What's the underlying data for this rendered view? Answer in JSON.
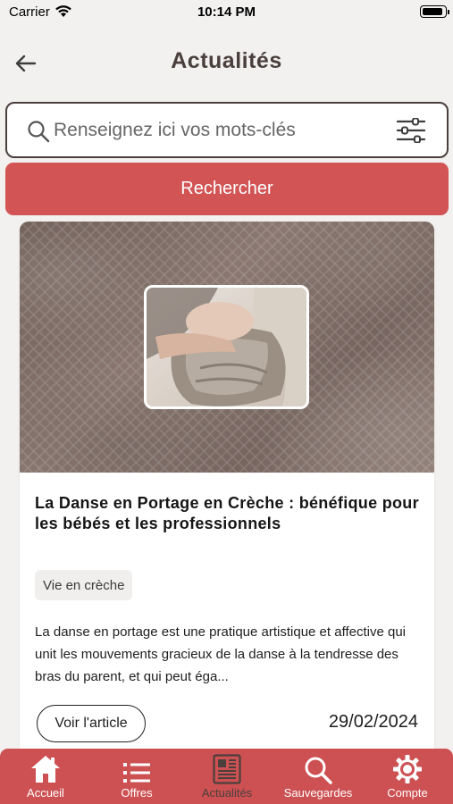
{
  "status_bar": {
    "carrier": "Carrier",
    "time": "10:14 PM"
  },
  "header": {
    "title": "Actualités"
  },
  "search": {
    "placeholder": "Renseignez ici vos mots-clés",
    "value": "",
    "button_label": "Rechercher"
  },
  "article": {
    "title": "La Danse en Portage en Crèche : bénéfique pour les bébés et les professionnels",
    "tag": "Vie en crèche",
    "excerpt": "La danse en portage est une pratique artistique et affective qui unit les mouvements gracieux de la danse à la tendresse des bras du parent, et qui peut éga...",
    "button_label": "Voir l'article",
    "date": "29/02/2024"
  },
  "tabbar": {
    "items": [
      {
        "label": "Accueil",
        "icon": "home-icon",
        "active": false
      },
      {
        "label": "Offres",
        "icon": "list-icon",
        "active": false
      },
      {
        "label": "Actualités",
        "icon": "newspaper-icon",
        "active": true
      },
      {
        "label": "Sauvegardes",
        "icon": "search-icon",
        "active": false
      },
      {
        "label": "Compte",
        "icon": "gear-icon",
        "active": false
      }
    ]
  },
  "colors": {
    "accent": "#cd5153",
    "title_brown": "#4a3f3c",
    "background": "#f2f1f0",
    "active_tab_label": "#4b3f3c"
  }
}
